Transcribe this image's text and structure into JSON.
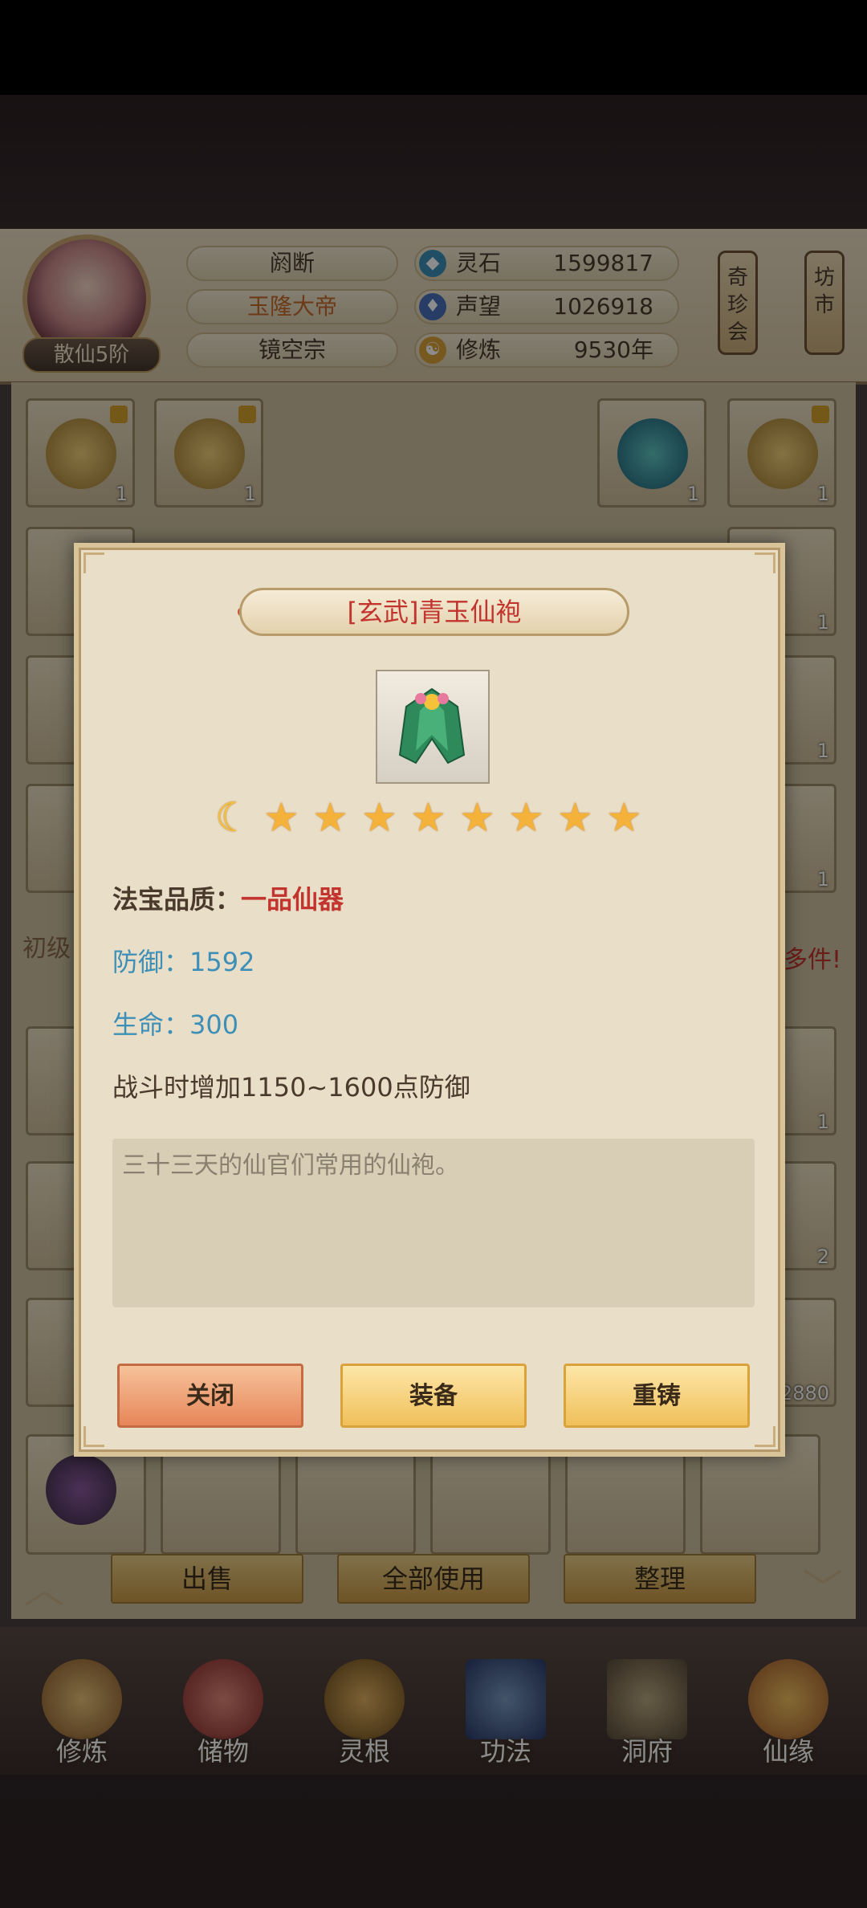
{
  "player": {
    "rank": "散仙5阶",
    "name": "阏断",
    "title": "玉隆大帝",
    "sect": "镜空宗"
  },
  "stats": [
    {
      "icon": "spirit-stone-icon",
      "label": "灵石",
      "value": "1599817"
    },
    {
      "icon": "reputation-icon",
      "label": "声望",
      "value": "1026918"
    },
    {
      "icon": "cultivation-icon",
      "label": "修炼",
      "value": "9530年"
    }
  ],
  "side_buttons": {
    "treasure": "奇珍会",
    "market": "坊市"
  },
  "bag": {
    "partial_left": "初级",
    "partial_right": "多件!",
    "counts": [
      "1",
      "1",
      "1",
      "1",
      "1",
      "1",
      "1",
      "1",
      "1",
      "1",
      "1",
      "2",
      "2880"
    ]
  },
  "bottom_actions": {
    "sell": "出售",
    "use_all": "全部使用",
    "sort": "整理"
  },
  "nav": [
    "修炼",
    "储物",
    "灵根",
    "功法",
    "洞府",
    "仙缘"
  ],
  "dialog": {
    "title": "[玄武]青玉仙袍",
    "star_count": 8,
    "quality_label": "法宝品质：",
    "quality_value": "一品仙器",
    "defense": "防御：1592",
    "life": "生命：300",
    "effect": "战斗时增加1150~1600点防御",
    "description": "三十三天的仙官们常用的仙袍。",
    "buttons": {
      "close": "关闭",
      "equip": "装备",
      "reforge": "重铸"
    }
  },
  "colors": {
    "quality_red": "#c2342d",
    "stat_blue": "#3e8fb8",
    "title_orange": "#c56a2a"
  }
}
